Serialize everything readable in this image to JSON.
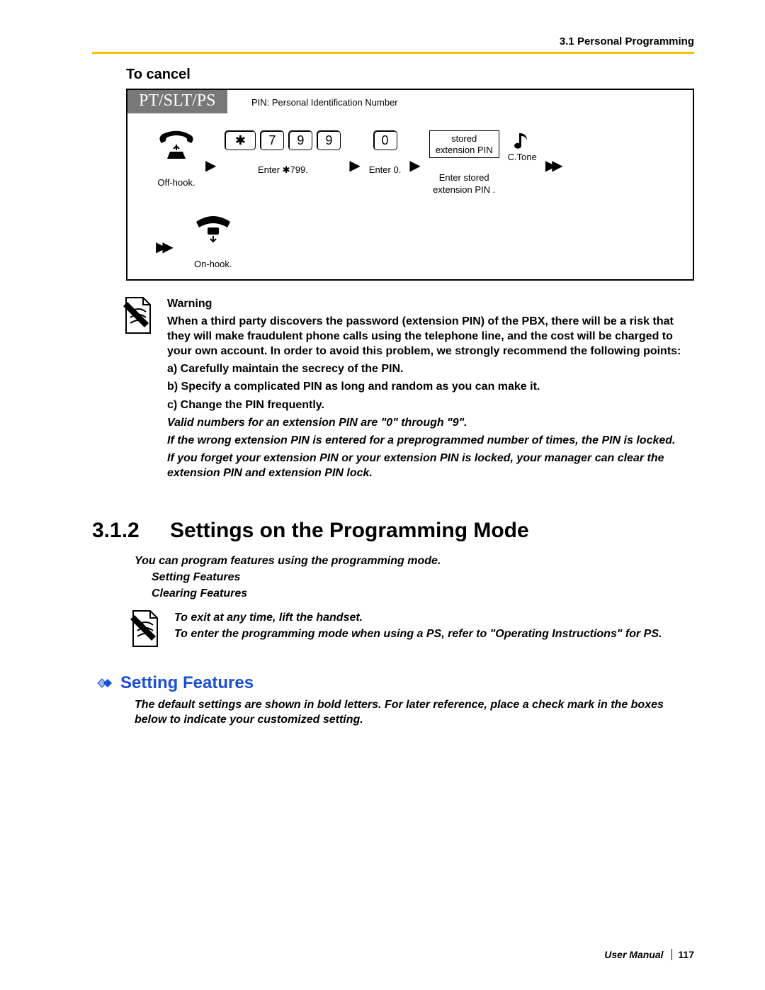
{
  "header": {
    "section": "3.1 Personal Programming"
  },
  "cancel_heading": "To cancel",
  "proc": {
    "tab": "PT/SLT/PS",
    "pin_note": "PIN: Personal Identification Number",
    "keys": {
      "star": "✱",
      "k7": "7",
      "k9a": "9",
      "k9b": "9",
      "k0": "0"
    },
    "pinbox_line1": "stored",
    "pinbox_line2": "extension PIN",
    "ctone": "C.Tone",
    "cap_offhook": "Off-hook.",
    "cap_enter799": "Enter ✱799.",
    "cap_enter0": "Enter 0.",
    "cap_storedpin1": "Enter stored",
    "cap_storedpin2": "extension PIN .",
    "cap_onhook": "On-hook."
  },
  "warning": {
    "title": "Warning",
    "body": "When a third party discovers the password (extension PIN) of the PBX, there will be a risk that they will make fraudulent phone calls using the telephone line, and the cost will be charged to your own account. In order to avoid this problem, we strongly recommend the following points:",
    "a": "a) Carefully maintain the secrecy of the PIN.",
    "b": "b) Specify a complicated PIN as long and random as you can make it.",
    "c": "c) Change the PIN frequently.",
    "valid": "Valid numbers for an extension PIN are \"0\" through \"9\".",
    "wrong": "If the wrong extension PIN is entered for a preprogrammed number of times, the PIN is locked.",
    "forget": "If you forget your extension PIN or your extension PIN is locked, your manager can clear the extension PIN and extension PIN lock."
  },
  "sec312": {
    "num": "3.1.2",
    "title": "Settings on the Programming Mode",
    "intro": "You can program features using the programming mode.",
    "link1": "Setting Features",
    "link2": "Clearing Features",
    "tip1": "To exit at any time, lift the handset.",
    "tip2": "To enter the programming mode when using a PS, refer to \"Operating Instructions\" for PS."
  },
  "setting_features": {
    "heading": "Setting Features",
    "defaults": "The default settings are shown in bold letters. For later reference, place a check mark in the boxes below to indicate your customized setting."
  },
  "footer": {
    "manual": "User Manual",
    "page": "117"
  }
}
